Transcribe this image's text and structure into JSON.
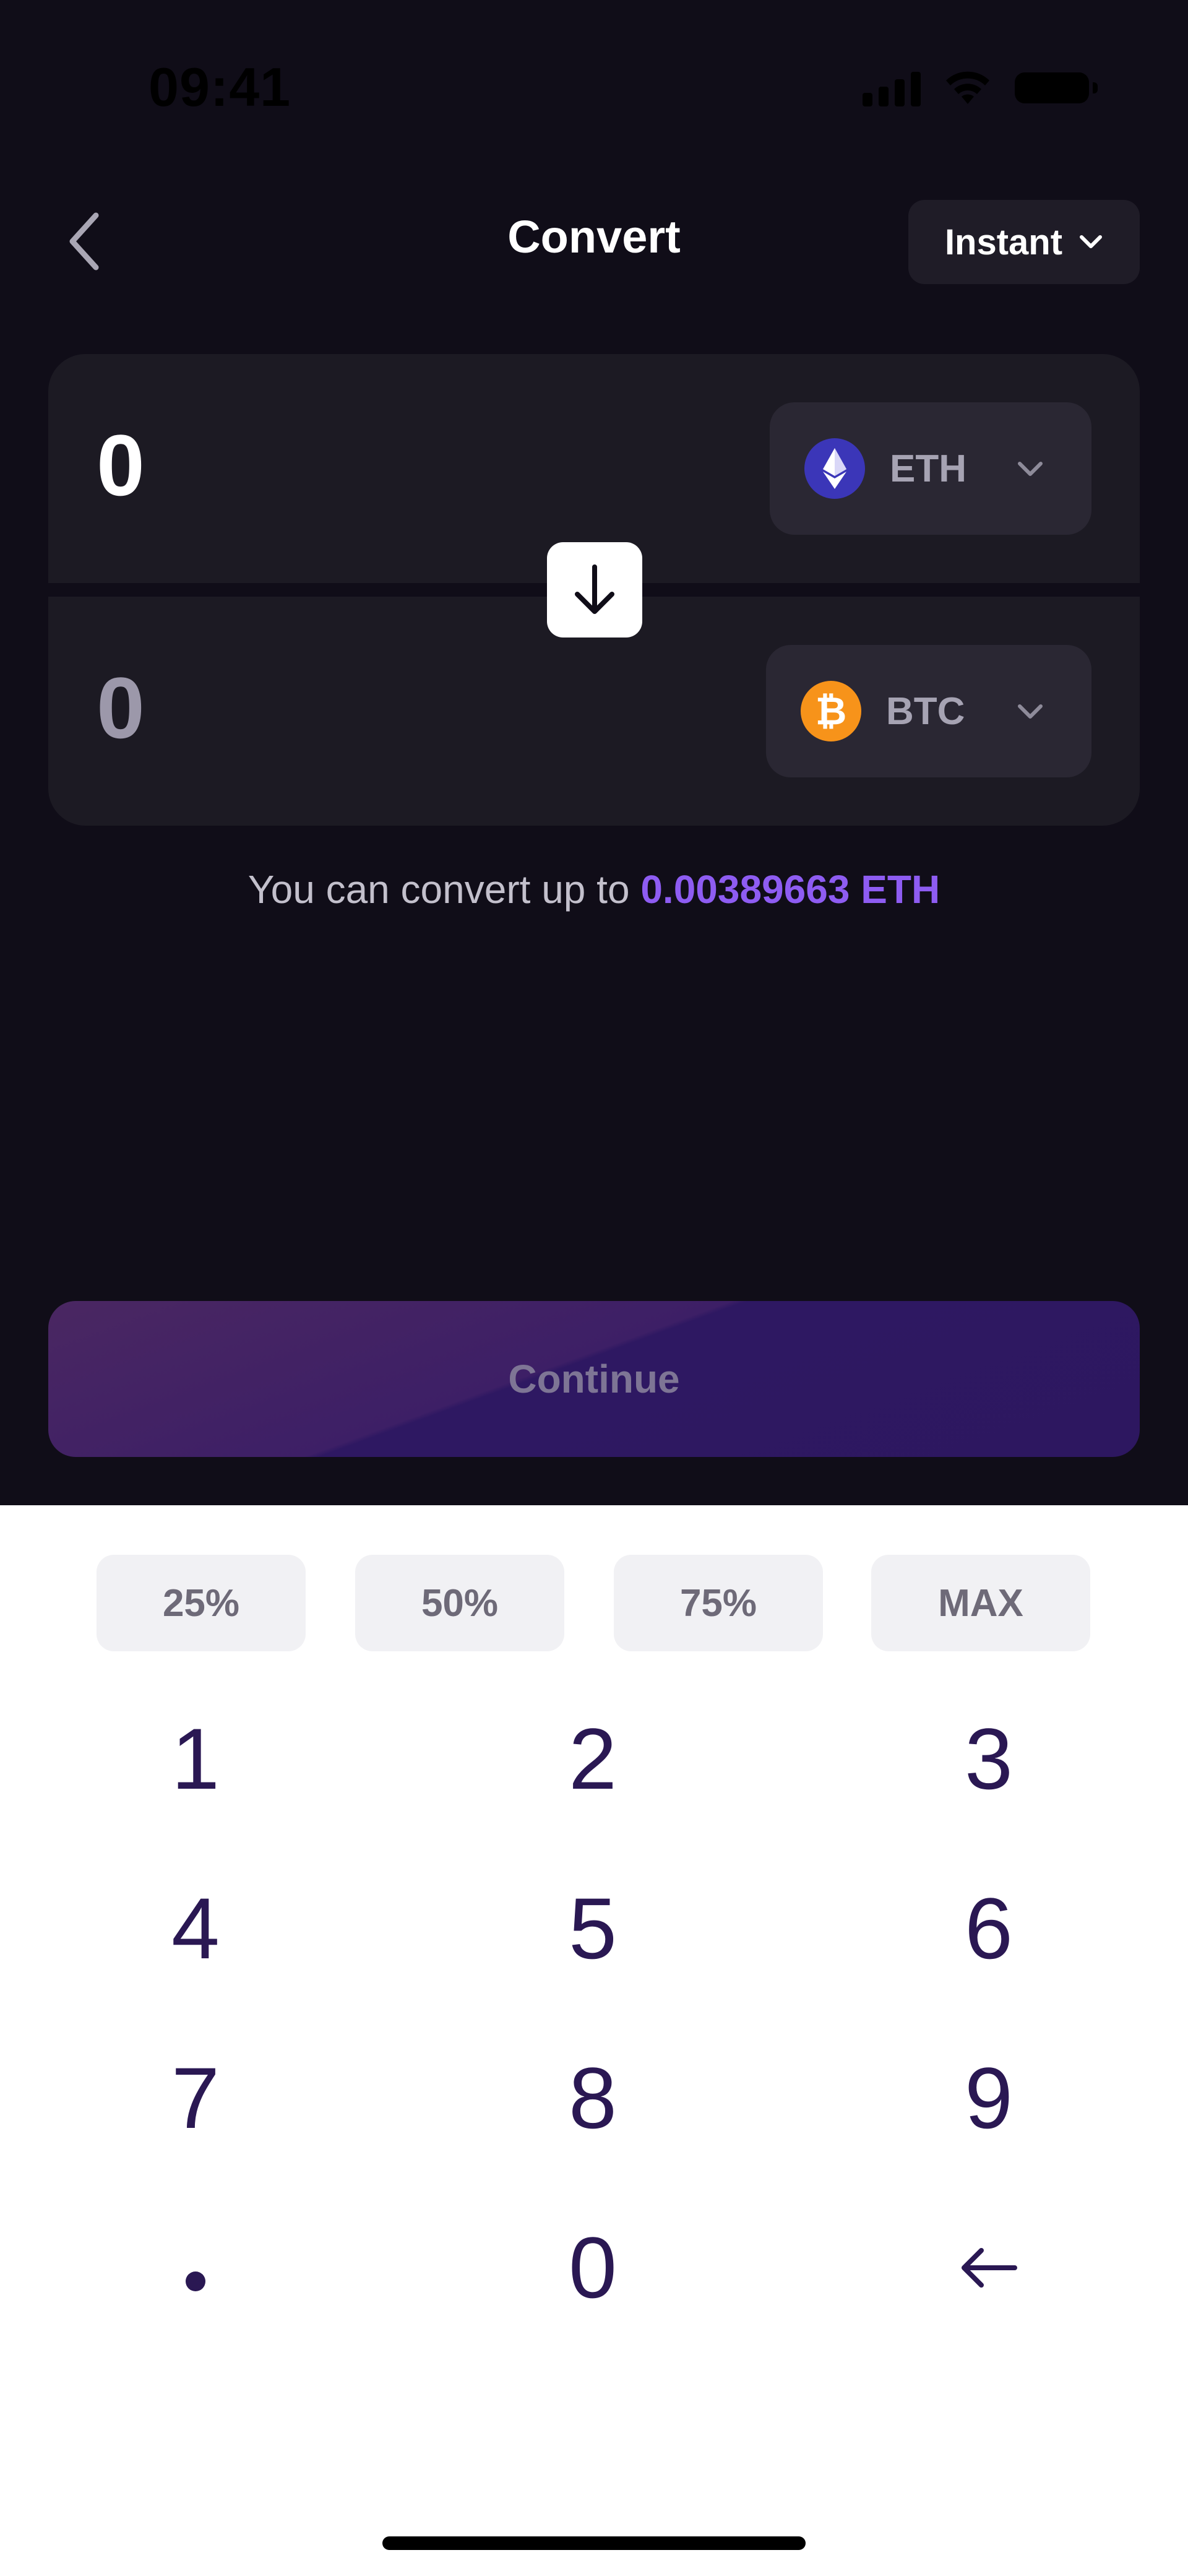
{
  "status_bar": {
    "time": "09:41"
  },
  "header": {
    "title": "Convert",
    "mode_select": {
      "selected": "Instant"
    }
  },
  "converter": {
    "from": {
      "amount": "0",
      "token": "ETH"
    },
    "to": {
      "amount": "0",
      "token": "BTC"
    }
  },
  "limit": {
    "prefix": "You can convert up to ",
    "amount": "0.00389663 ETH"
  },
  "continue_label": "Continue",
  "percent_buttons": [
    "25%",
    "50%",
    "75%",
    "MAX"
  ],
  "keypad": {
    "keys": [
      "1",
      "2",
      "3",
      "4",
      "5",
      "6",
      "7",
      "8",
      "9",
      ".",
      "0",
      "backspace"
    ]
  },
  "colors": {
    "background_dark": "#100d18",
    "panel": "#1c1a23",
    "accent": "#8e5cf2",
    "key_text": "#2a1853",
    "eth_icon": "#3b36b8",
    "btc_icon": "#f7931a"
  },
  "icons": {
    "back": "chevron-left-icon",
    "dropdown": "chevron-down-icon",
    "swap": "arrow-down-icon",
    "backspace": "arrow-left-icon",
    "eth": "ethereum-icon",
    "btc": "bitcoin-icon"
  }
}
